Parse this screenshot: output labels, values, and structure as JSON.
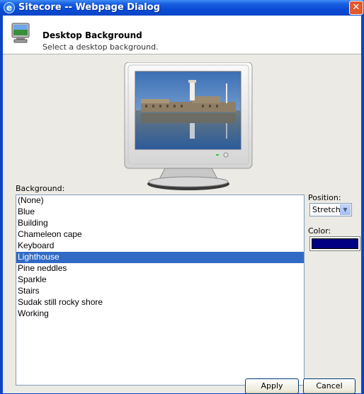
{
  "window": {
    "title": "Sitecore -- Webpage Dialog"
  },
  "header": {
    "title": "Desktop Background",
    "description": "Select a desktop background."
  },
  "background": {
    "label": "Background:",
    "items": [
      "(None)",
      "Blue",
      "Building",
      "Chameleon cape",
      "Keyboard",
      "Lighthouse",
      "Pine neddles",
      "Sparkle",
      "Stairs",
      "Sudak still rocky shore",
      "Working"
    ],
    "selected": "Lighthouse"
  },
  "position": {
    "label": "Position:",
    "value": "Stretch"
  },
  "color": {
    "label": "Color:",
    "value": "#000080"
  },
  "buttons": {
    "apply": "Apply",
    "cancel": "Cancel"
  },
  "colors": {
    "titlebar": "#0b46c5",
    "selection": "#316ac5",
    "dialog_bg": "#eceae4"
  }
}
